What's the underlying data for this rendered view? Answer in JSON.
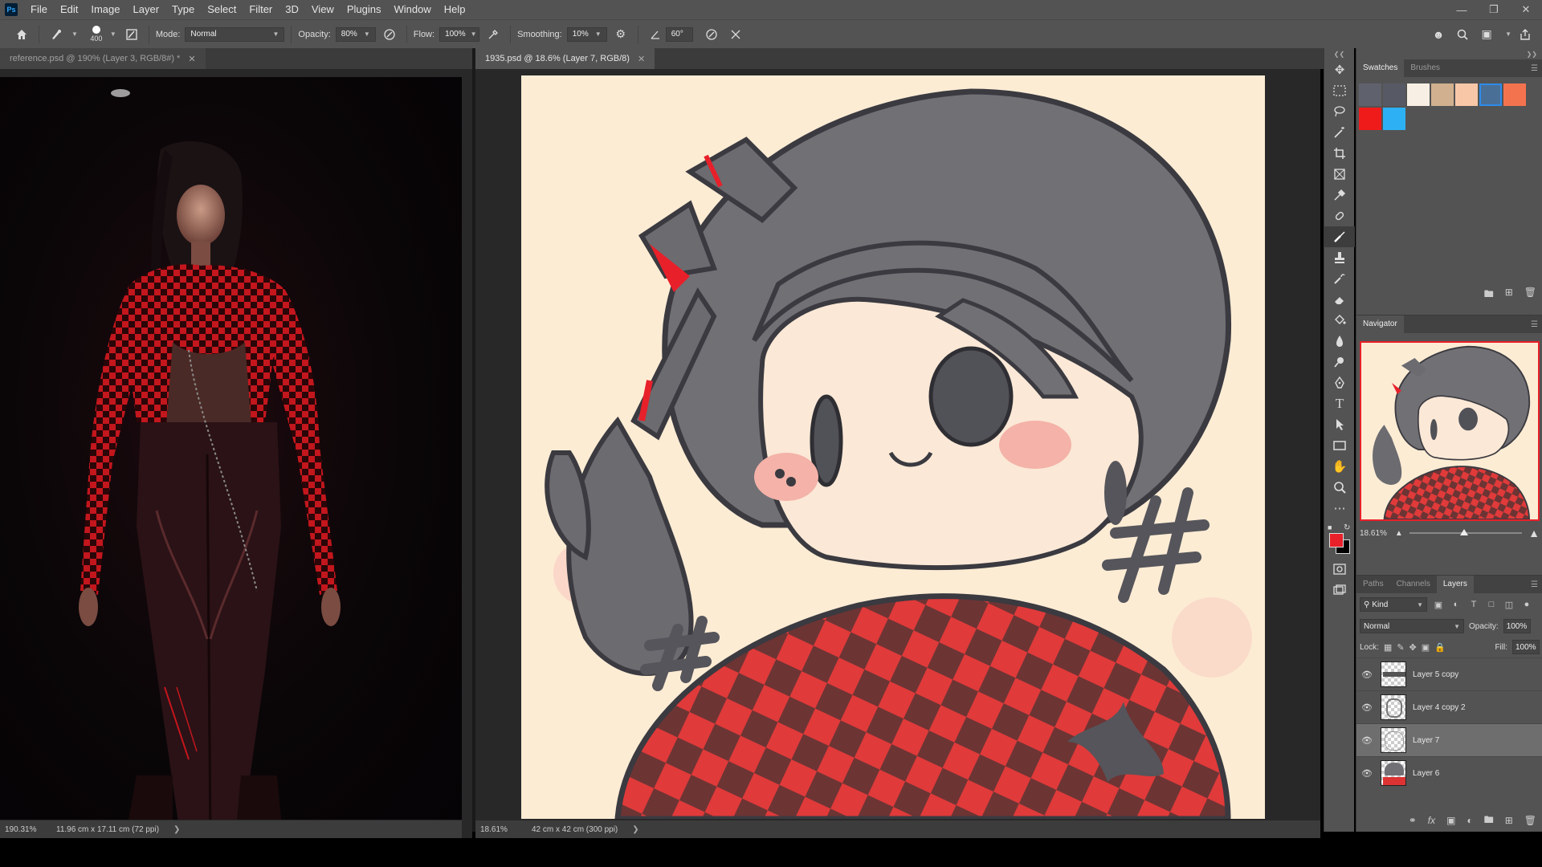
{
  "app": {
    "logo": "Ps"
  },
  "menu": [
    "File",
    "Edit",
    "Image",
    "Layer",
    "Type",
    "Select",
    "Filter",
    "3D",
    "View",
    "Plugins",
    "Window",
    "Help"
  ],
  "window_controls": [
    "minimize-icon",
    "restore-icon",
    "close-icon"
  ],
  "options": {
    "brush_size": "400",
    "mode_label": "Mode:",
    "mode_value": "Normal",
    "opacity_label": "Opacity:",
    "opacity_value": "80%",
    "flow_label": "Flow:",
    "flow_value": "100%",
    "smoothing_label": "Smoothing:",
    "smoothing_value": "10%",
    "angle_value": "60°"
  },
  "documents": {
    "reference": {
      "tab": "reference.psd @ 190% (Layer 3, RGB/8#) *",
      "zoom": "190.31%",
      "info": "11.96 cm x 17.11 cm (72 ppi)"
    },
    "main": {
      "tab": "1935.psd @ 18.6% (Layer 7, RGB/8)",
      "zoom": "18.61%",
      "info": "42 cm x 42 cm (300 ppi)"
    }
  },
  "tools": [
    "move-tool-icon",
    "marquee-tool-icon",
    "lasso-tool-icon",
    "magic-wand-icon",
    "crop-tool-icon",
    "frame-tool-icon",
    "eyedropper-icon",
    "healing-brush-icon",
    "brush-tool-icon",
    "clone-stamp-icon",
    "history-brush-icon",
    "eraser-icon",
    "paint-bucket-icon",
    "blur-tool-icon",
    "dodge-tool-icon",
    "pen-tool-icon",
    "type-tool-icon",
    "path-select-icon",
    "rectangle-tool-icon",
    "hand-tool-icon",
    "zoom-tool-icon",
    "more-tools-icon"
  ],
  "colors": {
    "foreground": "#e8202a",
    "background": "#000000",
    "accent": "#2d8ceb"
  },
  "swatches_panel": {
    "tabs": [
      "Swatches",
      "Brushes"
    ],
    "swatches": [
      "#5f626c",
      "#575a64",
      "#f7efe3",
      "#d0b08f",
      "#f7c7a7",
      "#4a6f96",
      "#f4734f",
      "#ef1b1b",
      "#2db1f4"
    ],
    "selected_index": 5
  },
  "navigator": {
    "title": "Navigator",
    "zoom": "18.61%"
  },
  "layers_panel": {
    "tabs": [
      "Paths",
      "Channels",
      "Layers"
    ],
    "kind": "Kind",
    "blend_mode": "Normal",
    "opacity_label": "Opacity:",
    "opacity_value": "100%",
    "lock_label": "Lock:",
    "fill_label": "Fill:",
    "fill_value": "100%",
    "layers": [
      {
        "name": "Layer 5 copy",
        "selected": false
      },
      {
        "name": "Layer 4 copy 2",
        "selected": false
      },
      {
        "name": "Layer 7",
        "selected": true
      },
      {
        "name": "Layer 6",
        "selected": false
      }
    ]
  }
}
